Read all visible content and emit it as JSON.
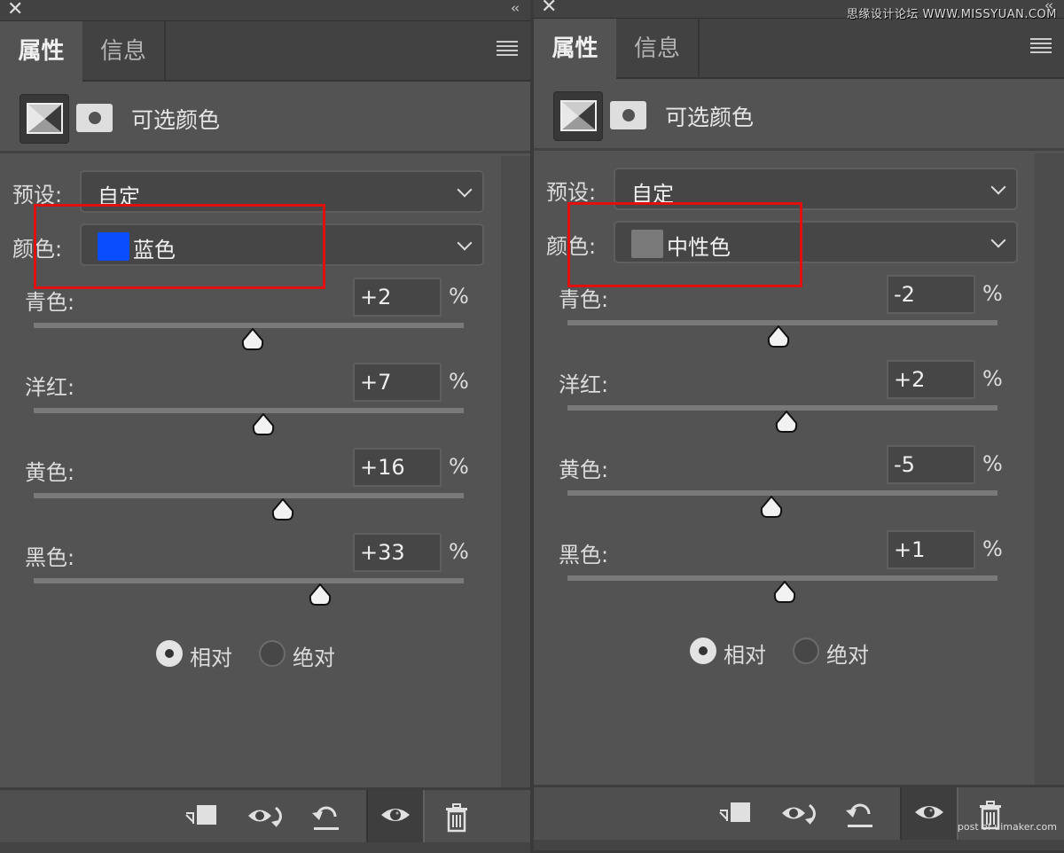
{
  "panels": [
    {
      "tabs": [
        "属性",
        "信息"
      ],
      "adjustment_title": "可选颜色",
      "preset_label": "预设:",
      "preset_value": "自定",
      "color_label": "颜色:",
      "color_value": "蓝色",
      "color_swatch": "#0a4dff",
      "sliders": [
        {
          "label": "青色:",
          "value": "+2",
          "unit": "%",
          "num": 2
        },
        {
          "label": "洋红:",
          "value": "+7",
          "unit": "%",
          "num": 7
        },
        {
          "label": "黄色:",
          "value": "+16",
          "unit": "%",
          "num": 16
        },
        {
          "label": "黑色:",
          "value": "+33",
          "unit": "%",
          "num": 33
        }
      ],
      "method_options": [
        "相对",
        "绝对"
      ],
      "method_selected": "相对",
      "highlight_color": "#e01010"
    },
    {
      "tabs": [
        "属性",
        "信息"
      ],
      "adjustment_title": "可选颜色",
      "preset_label": "预设:",
      "preset_value": "自定",
      "color_label": "颜色:",
      "color_value": "中性色",
      "color_swatch": "#7a7a7a",
      "sliders": [
        {
          "label": "青色:",
          "value": "-2",
          "unit": "%",
          "num": -2
        },
        {
          "label": "洋红:",
          "value": "+2",
          "unit": "%",
          "num": 2
        },
        {
          "label": "黄色:",
          "value": "-5",
          "unit": "%",
          "num": -5
        },
        {
          "label": "黑色:",
          "value": "+1",
          "unit": "%",
          "num": 1
        }
      ],
      "method_options": [
        "相对",
        "绝对"
      ],
      "method_selected": "相对",
      "highlight_color": "#e01010"
    }
  ],
  "slider_range": [
    -100,
    100
  ],
  "footer_icons": [
    "clip-to-layer-icon",
    "view-previous-state-icon",
    "reset-icon",
    "visibility-eye-icon",
    "trash-icon"
  ],
  "watermarks": {
    "top": "思缘设计论坛 WWW.MISSYUAN.COM",
    "bottom": "post of uimaker.com"
  }
}
